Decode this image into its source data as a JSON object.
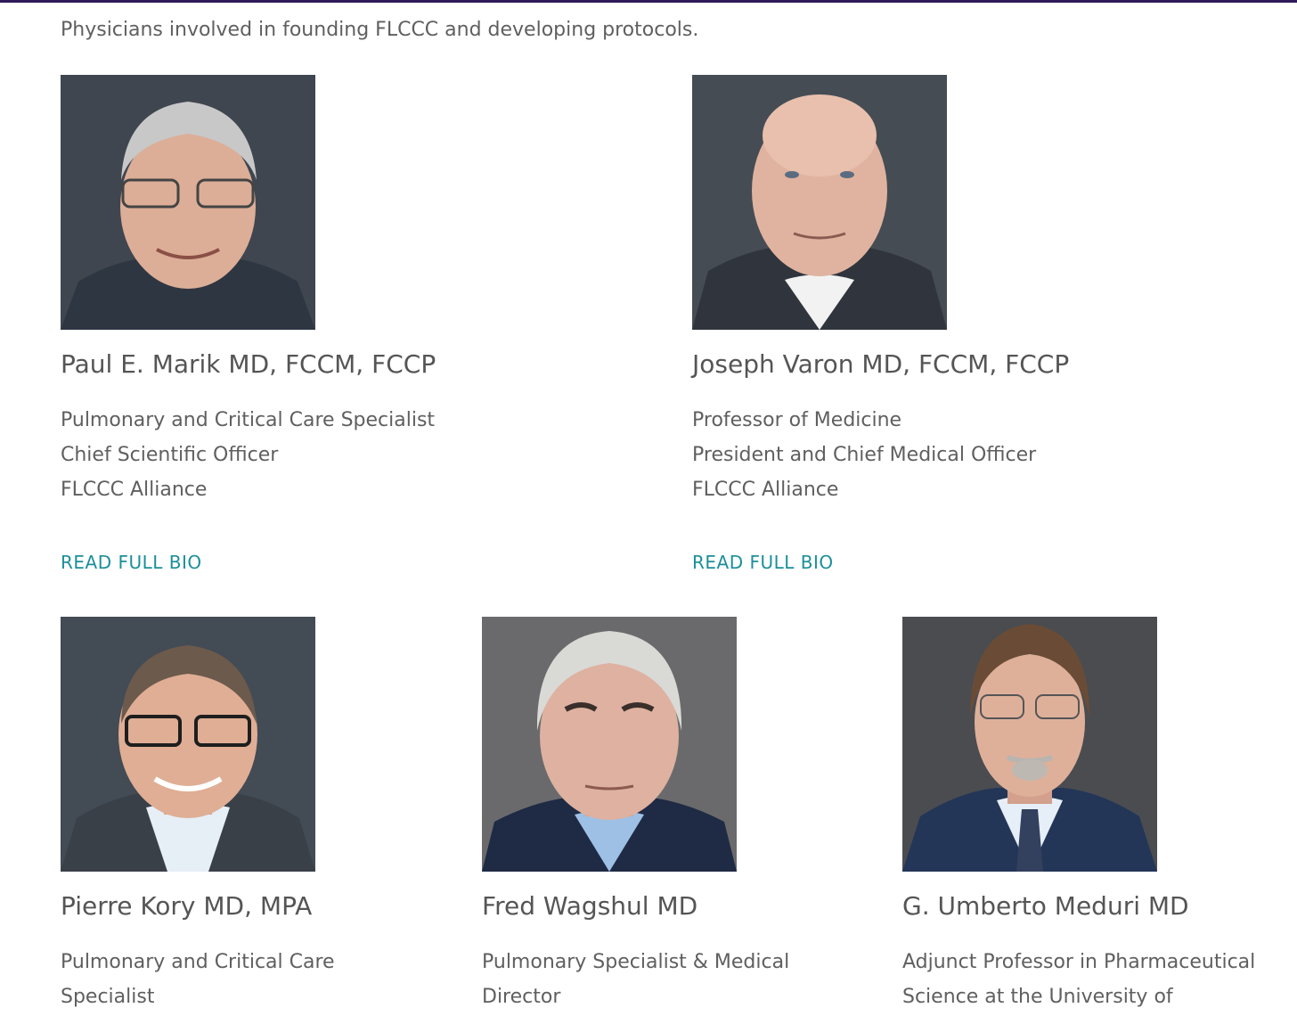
{
  "intro": "Physicians involved in founding FLCCC and developing protocols.",
  "read_more_label": "READ FULL BIO",
  "members": [
    {
      "name": "Paul E. Marik MD, FCCM, FCCP",
      "lines": [
        "Pulmonary and Critical Care Specialist",
        "Chief Scientific Officer",
        "FLCCC Alliance"
      ]
    },
    {
      "name": "Joseph Varon MD, FCCM, FCCP",
      "lines": [
        "Professor of Medicine",
        "President and Chief Medical Officer",
        "FLCCC Alliance"
      ]
    },
    {
      "name": "Pierre Kory MD, MPA",
      "lines": [
        "Pulmonary and Critical Care",
        "Specialist"
      ]
    },
    {
      "name": "Fred Wagshul MD",
      "lines": [
        "Pulmonary Specialist & Medical",
        "Director"
      ]
    },
    {
      "name": "G. Umberto Meduri MD",
      "lines": [
        "Adjunct Professor in Pharmaceutical",
        "Science at the University of"
      ]
    }
  ]
}
